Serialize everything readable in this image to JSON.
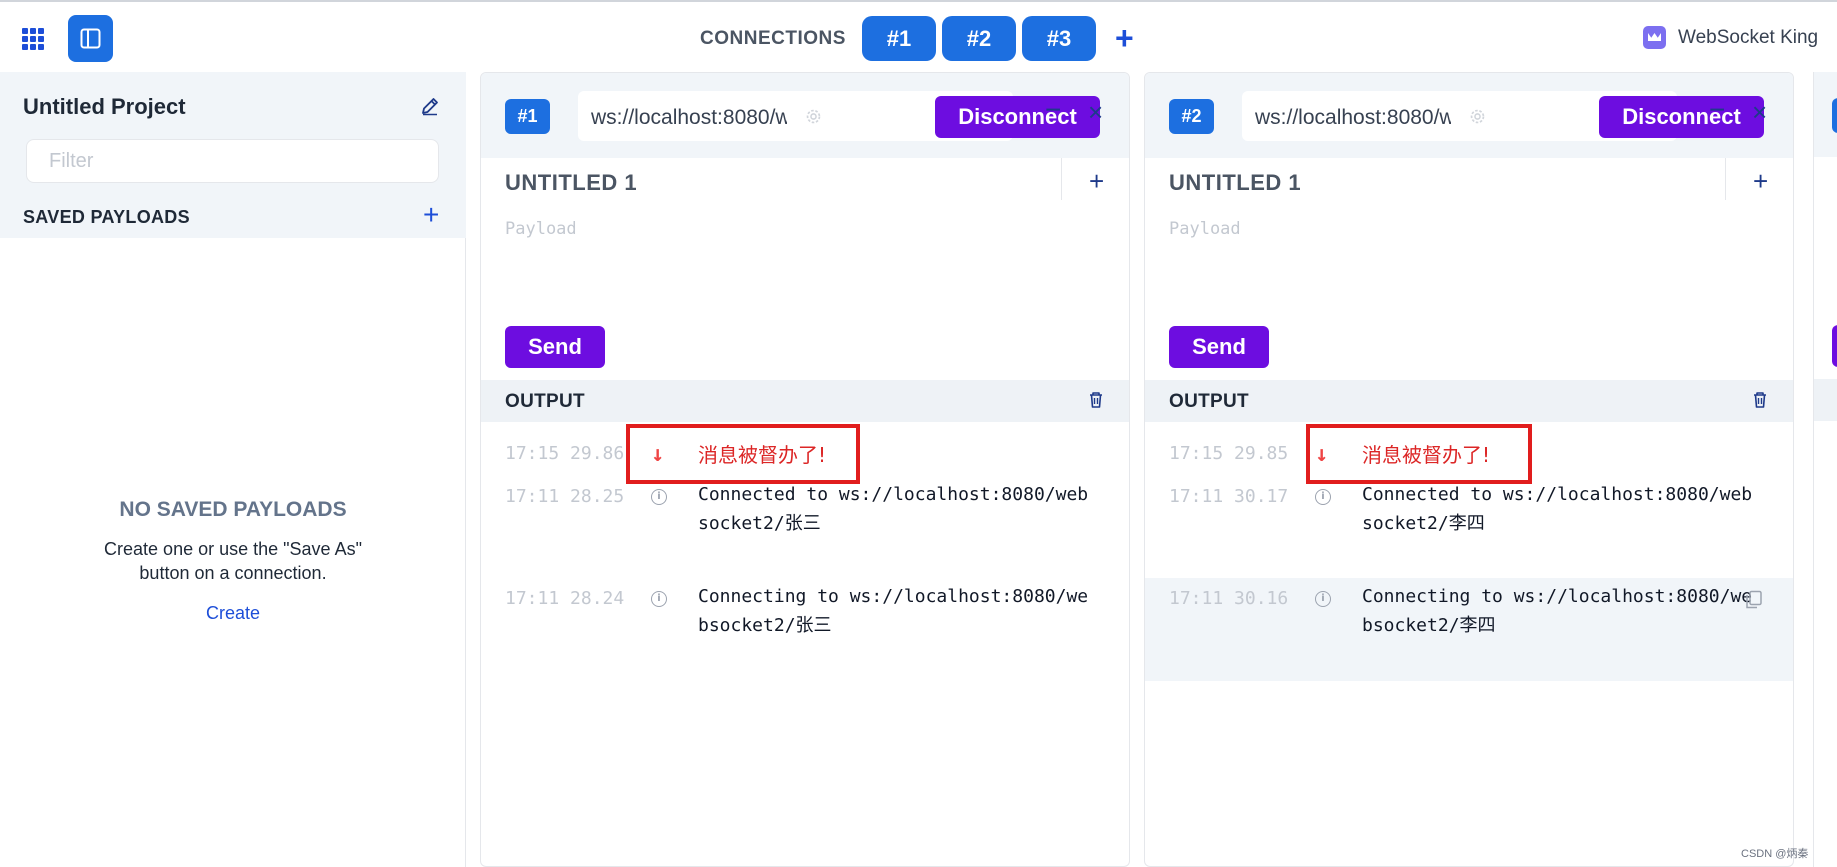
{
  "topbar": {
    "connections_label": "CONNECTIONS",
    "tabs": [
      {
        "label": "#1"
      },
      {
        "label": "#2"
      },
      {
        "label": "#3"
      }
    ],
    "add_label": "+",
    "brand_name": "WebSocket King"
  },
  "sidebar": {
    "project_title": "Untitled Project",
    "filter_placeholder": "Filter",
    "saved_payloads_label": "SAVED PAYLOADS",
    "add_label": "+",
    "empty_title": "NO SAVED PAYLOADS",
    "empty_description": "Create one or use the \"Save As\" button on a connection.",
    "create_label": "Create"
  },
  "panels": [
    {
      "badge": "#1",
      "url": "ws://localhost:8080/websocket2/张三",
      "disconnect_label": "Disconnect",
      "minimize_label": "−",
      "close_label": "×",
      "tab_name": "UNTITLED 1",
      "tab_add_label": "+",
      "payload_placeholder": "Payload",
      "send_label": "Send",
      "output_label": "OUTPUT",
      "logs": [
        {
          "time": "17:15 29.86",
          "type": "received",
          "message": "消息被督办了!"
        },
        {
          "time": "17:11 28.25",
          "type": "info",
          "message": "Connected to ws://localhost:8080/websocket2/张三"
        },
        {
          "time": "17:11 28.24",
          "type": "info",
          "message": "Connecting to ws://localhost:8080/websocket2/张三"
        }
      ]
    },
    {
      "badge": "#2",
      "url": "ws://localhost:8080/websocket2/李四",
      "disconnect_label": "Disconnect",
      "minimize_label": "−",
      "close_label": "×",
      "tab_name": "UNTITLED 1",
      "tab_add_label": "+",
      "payload_placeholder": "Payload",
      "send_label": "Send",
      "output_label": "OUTPUT",
      "logs": [
        {
          "time": "17:15 29.85",
          "type": "received",
          "message": "消息被督办了!"
        },
        {
          "time": "17:11 30.17",
          "type": "info",
          "message": "Connected to ws://localhost:8080/websocket2/李四"
        },
        {
          "time": "17:11 30.16",
          "type": "info",
          "message": "Connecting to ws://localhost:8080/websocket2/李四"
        }
      ]
    }
  ],
  "watermark": "CSDN @炳秦",
  "colors": {
    "primary_blue": "#1d6fe0",
    "purple": "#6d0de0",
    "highlight_red": "#e11d1d",
    "received_red": "#dc2626"
  },
  "icons": [
    "grid-icon",
    "sidebar-toggle-icon",
    "crown-icon",
    "edit-icon",
    "gear-icon",
    "trash-icon",
    "arrow-down-icon",
    "info-icon",
    "copy-icon"
  ]
}
